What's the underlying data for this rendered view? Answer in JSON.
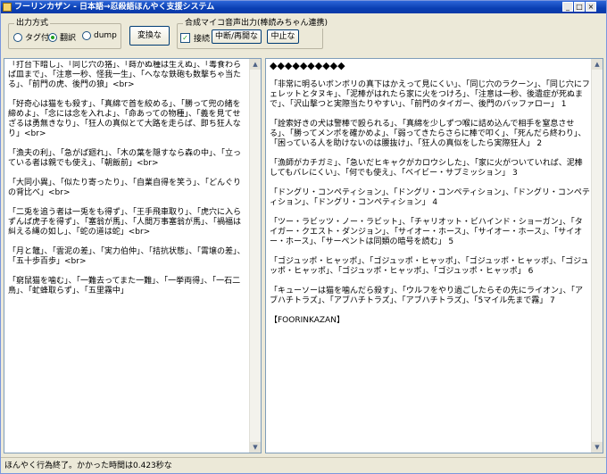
{
  "window": {
    "title": "フーリンカザン - 日本語→忍殺語ほんやく支援システム"
  },
  "titlebar_buttons": [
    "_",
    "□",
    "×"
  ],
  "output_group": {
    "label": "出力方式",
    "options": [
      {
        "label": "タグ付",
        "selected": false
      },
      {
        "label": "翻訳",
        "selected": true
      },
      {
        "label": "dump",
        "selected": false
      }
    ]
  },
  "convert_button": "変換な",
  "speech_group": {
    "label": "合成マイコ音声出力(棒読みちゃん連携)",
    "checkbox_label": "接続",
    "checked": true,
    "pause_resume": "中断/再開な",
    "stop": "中止な"
  },
  "left_pane": {
    "paragraphs": [
      "「打台下暗し」、「同じ穴の狢」、「蒔かぬ種は生えぬ」、「毒食わらば皿まで」、「注意一秒、怪我一生」、「へなな鉄砲も数撃ちゃ当たる」、「前門の虎、後門の狼」<br>",
      "「好奇心は猫をも殺す」、「真綿で首を絞める」、「勝って兜の緒を締めよ」、「念には念を入れよ」、「命あっての物種」、「義を見てせざるは勇無きなり」、「狂人の真似とて大路を走らば、即ち狂人なり」<br>",
      "「漁夫の利」、「急がば廻れ」、「木の葉を隠すなら森の中」、「立っている者は親でも使え」、「朝飯前」<br>",
      "「大同小異」、「似たり寄ったり」、「自業自得を笑う」、「どんぐりの背比べ」<br>",
      "「二兎を追う者は一兎をも得ず」、「王手飛車取り」、「虎穴に入らずんば虎子を得ず」、「塞翁が馬」、「人間万事塞翁が馬」、「禍福は糾える縄の如し」、「蛇の道は蛇」<br>",
      "「月と鼈」、「雲泥の差」、「実力伯仲」、「拮抗状態」、「霄壌の差」、「五十歩百歩」<br>",
      "「窮鼠猫を噛む」、「一難去ってまた一難」、「一挙両得」、「一石二鳥」、「虻蜂取らず」、「五里霧中」"
    ]
  },
  "right_pane": {
    "paragraphs": [
      "◆◆◆◆◆◆◆◆◆◆",
      "「非常に明るいボンボリの真下はかえって見にくい」、「同じ穴のラクーン」、「同じ穴にフェレットとタヌキ」、「泥棒がはれたら家に火をつけろ」、「注意は一秒、後遺症が死ぬまで」、「沢山撃つと実際当たりやすい」、「前門のタイガー、後門のバッファロー」 1",
      "「詮索好きの犬は警棒で殴られる」、「真綿を少しずつ喉に詰め込んで相手を窒息させる」、「勝ってメンポを確かめよ」、「弱ってきたらさらに棒で叩く」、「死んだら終わり」、「困っている人を助けないのは腰抜け」、「狂人の真似をしたら実際狂人」 2",
      "「漁師がカチガミ」、「急いだヒキャクがカロウシした」、「家に火がついていれば、泥棒してもバレにくい」、「何でも使え」、「ベイビー・サブミッション」 3",
      "「ドングリ・コンペティション」、「ドングリ・コンペティション」、「ドングリ・コンペティション」、「ドングリ・コンペティション」 4",
      "「ツー・ラビッツ・ノー・ラビット」、「チャリオット・ビハインド・ショーガン」、「タイガー・クエスト・ダンジョン」、「サイオー・ホース」、「サイオー・ホース」、「サイオー・ホース」、「サーペントは同類の暗号を読む」 5",
      "「ゴジュッポ・ヒャッポ」、「ゴジュッポ・ヒャッポ」、「ゴジュッポ・ヒャッポ」、「ゴジュッポ・ヒャッポ」、「ゴジュッポ・ヒャッポ」、「ゴジュッポ・ヒャッポ」 6",
      "「キューソーは猫を噛んだら殺す」、「ウルフをやり過ごしたらその先にライオン」、「アブハチトラズ」、「アブハチトラズ」、「アブハチトラズ」、「5マイル先まで霧」 7",
      "【FOORINKAZAN】"
    ]
  },
  "status": {
    "text": "ほんやく行為終了。かかった時間は0.423秒な"
  }
}
